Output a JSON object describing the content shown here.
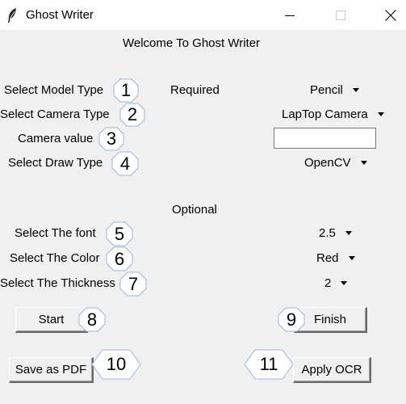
{
  "window": {
    "title": "Ghost Writer",
    "controls": [
      "minimize",
      "maximize",
      "close"
    ]
  },
  "header": {
    "welcome": "Welcome To Ghost Writer"
  },
  "sections": {
    "required": "Required",
    "optional": "Optional"
  },
  "fields": {
    "model_type": {
      "label": "Select Model Type",
      "value": "Pencil"
    },
    "camera_type": {
      "label": "Select Camera Type",
      "value": "LapTop Camera"
    },
    "camera_value": {
      "label": "Camera value",
      "value": ""
    },
    "draw_type": {
      "label": "Select Draw Type",
      "value": "OpenCV"
    },
    "font": {
      "label": "Select The font",
      "value": "2.5"
    },
    "color": {
      "label": "Select The Color",
      "value": "Red"
    },
    "thickness": {
      "label": "Select The Thickness",
      "value": "2"
    }
  },
  "buttons": {
    "start": "Start",
    "finish": "Finish",
    "save_pdf": "Save as PDF",
    "apply_ocr": "Apply OCR"
  },
  "callouts": [
    "1",
    "2",
    "3",
    "4",
    "5",
    "6",
    "7",
    "8",
    "9",
    "10",
    "11"
  ],
  "icons": {
    "app": "feather-icon",
    "dropdown": "triangle-down-icon"
  },
  "colors": {
    "background": "#f0f0f0",
    "titlebar": "#ffffff"
  }
}
